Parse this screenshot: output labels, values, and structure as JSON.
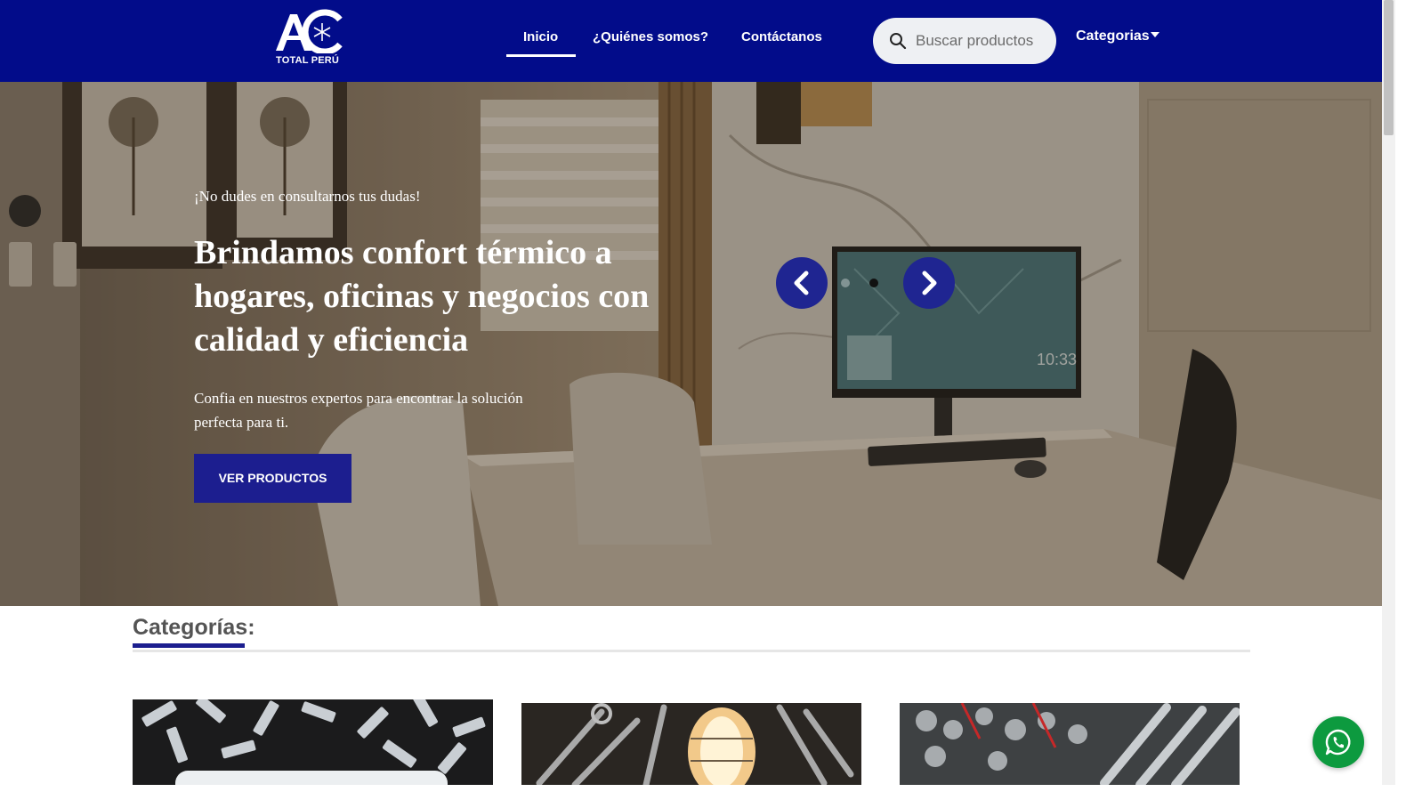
{
  "brand": {
    "logo_text": "TOTAL PERÚ"
  },
  "nav": {
    "items": [
      {
        "label": "Inicio",
        "active": true
      },
      {
        "label": "¿Quiénes somos?"
      },
      {
        "label": "Contáctanos"
      }
    ],
    "search": {
      "placeholder": "Buscar productos",
      "icon": "search-icon"
    },
    "categories_label": "Categorias",
    "categories_icon": "caret-down-icon"
  },
  "hero": {
    "kicker": "¡No dudes en consultarnos tus dudas!",
    "title": "Brindamos confort térmico a hogares, oficinas y negocios con calidad y eficiencia",
    "description": "Confia en nuestros expertos para encontrar la solución perfecta para ti.",
    "cta_label": "VER PRODUCTOS",
    "slider": {
      "prev_icon": "chevron-left-icon",
      "next_icon": "chevron-right-icon",
      "slides": 2,
      "active_slide": 2
    },
    "monitor_clock": "10:33"
  },
  "categories": {
    "title": "Categorías:",
    "cards": [
      {
        "image": "air-conditioner-units-image"
      },
      {
        "image": "tools-and-lamp-image"
      },
      {
        "image": "socket-wrench-set-image"
      }
    ]
  },
  "whatsapp": {
    "icon": "whatsapp-icon"
  },
  "colors": {
    "primary": "#020c8a",
    "accent_button": "#1c1e8f",
    "whatsapp": "#0d9a3f"
  }
}
